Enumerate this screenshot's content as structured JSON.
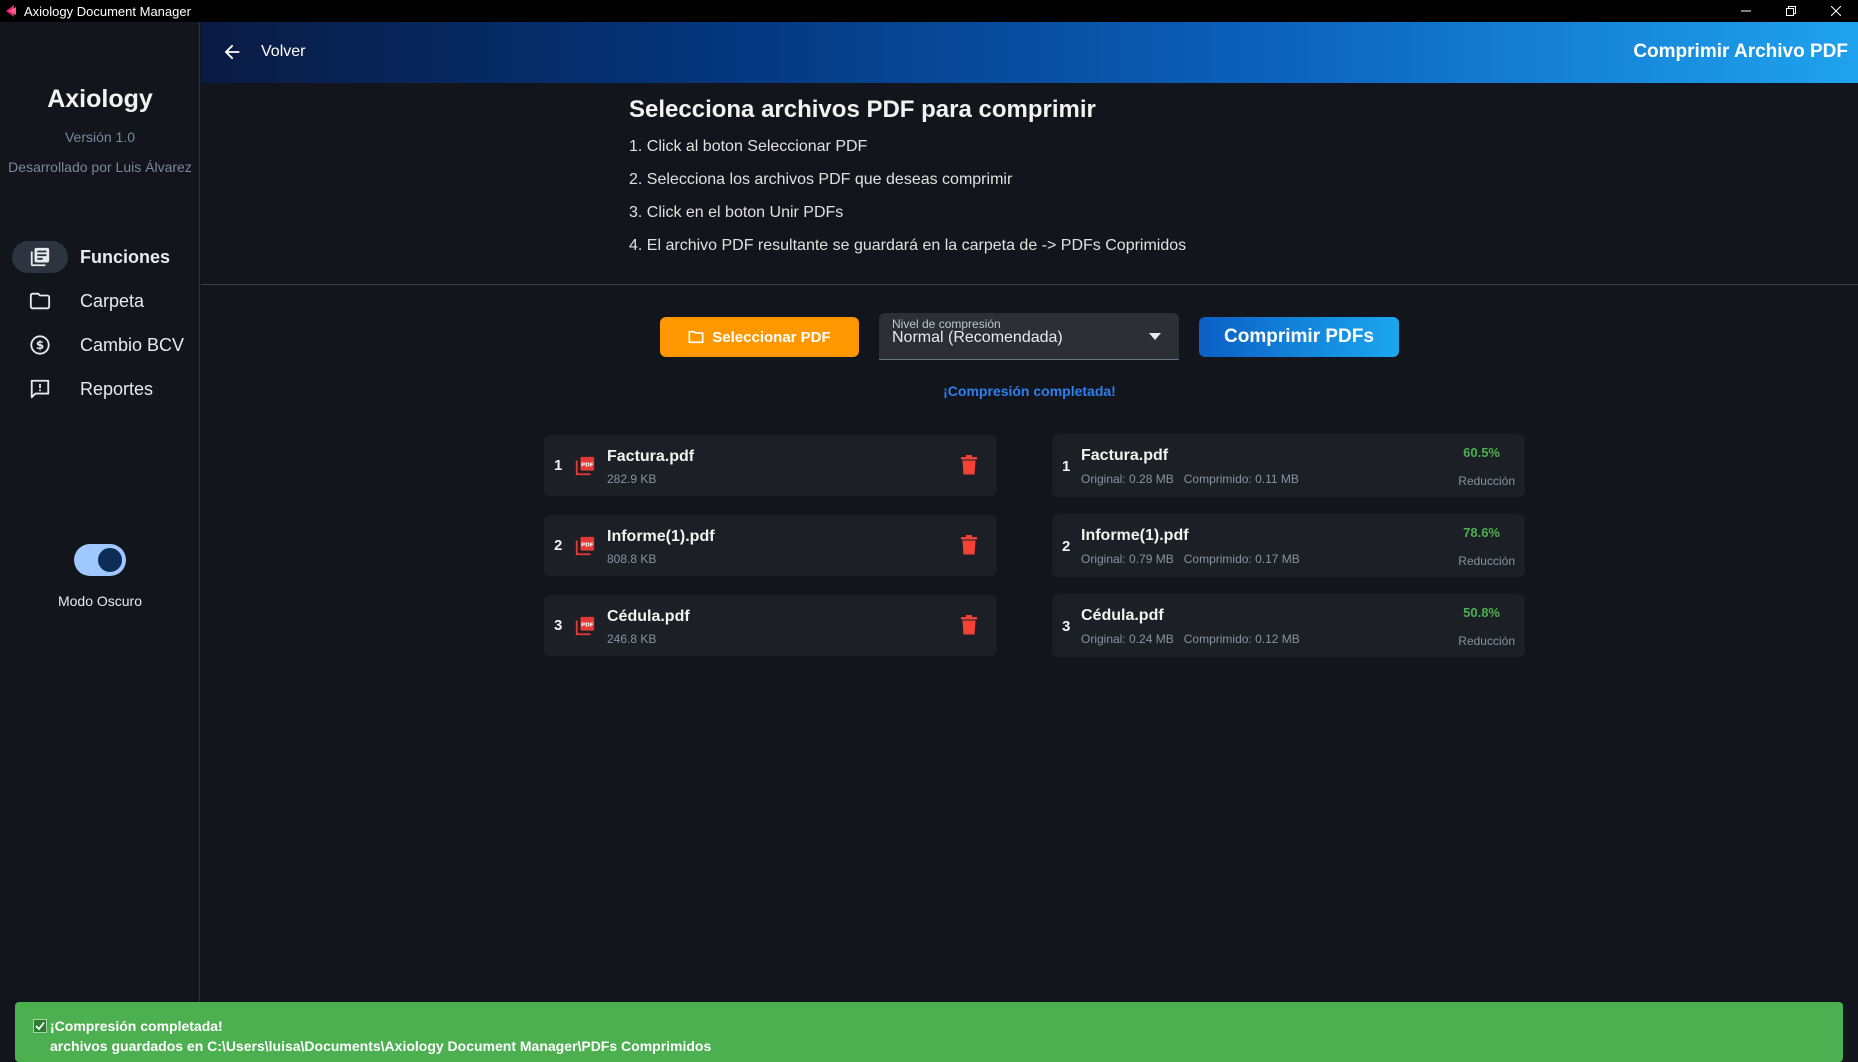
{
  "window": {
    "title": "Axiology Document Manager"
  },
  "sidebar": {
    "brand": "Axiology",
    "version": "Versión 1.0",
    "developer": "Desarrollado por Luis Álvarez",
    "items": [
      {
        "label": "Funciones",
        "icon": "library-books-icon",
        "active": true
      },
      {
        "label": "Carpeta",
        "icon": "folder-icon",
        "active": false
      },
      {
        "label": "Cambio BCV",
        "icon": "dollar-circle-icon",
        "active": false
      },
      {
        "label": "Reportes",
        "icon": "report-icon",
        "active": false
      }
    ],
    "dark_mode_label": "Modo Oscuro",
    "dark_mode_on": true
  },
  "header": {
    "back_label": "Volver",
    "title": "Comprimir Archivo PDF"
  },
  "instructions": {
    "title": "Selecciona archivos PDF para comprimir",
    "steps": [
      "1. Click al boton Seleccionar PDF",
      "2. Selecciona los archivos PDF que deseas comprimir",
      "3. Click en el boton Unir PDFs",
      "4. El archivo PDF resultante se guardará en la carpeta de -> PDFs Coprimidos"
    ]
  },
  "controls": {
    "select_label": "Seleccionar PDF",
    "compression_label": "Nivel de compresión",
    "compression_value": "Normal (Recomendada)",
    "compress_label": "Comprimir PDFs",
    "status": "¡Compresión completada!"
  },
  "files": [
    {
      "num": "1",
      "name": "Factura.pdf",
      "size": "282.9 KB"
    },
    {
      "num": "2",
      "name": "Informe(1).pdf",
      "size": "808.8 KB"
    },
    {
      "num": "3",
      "name": "Cédula.pdf",
      "size": "246.8 KB"
    }
  ],
  "results": [
    {
      "num": "1",
      "name": "Factura.pdf",
      "original": "Original: 0.28 MB",
      "compressed": "Comprimido: 0.11 MB",
      "pct": "60.5%",
      "reduction_label": "Reducción"
    },
    {
      "num": "2",
      "name": "Informe(1).pdf",
      "original": "Original: 0.79 MB",
      "compressed": "Comprimido: 0.17 MB",
      "pct": "78.6%",
      "reduction_label": "Reducción"
    },
    {
      "num": "3",
      "name": "Cédula.pdf",
      "original": "Original: 0.24 MB",
      "compressed": "Comprimido: 0.12 MB",
      "pct": "50.8%",
      "reduction_label": "Reducción"
    }
  ],
  "snackbar": {
    "line1": "¡Compresión completada!",
    "line2": "archivos guardados en C:\\Users\\luisa\\Documents\\Axiology Document Manager\\PDFs Comprimidos"
  },
  "colors": {
    "accent_orange": "#ff9800",
    "accent_blue": "#0b5fc4",
    "success_green": "#4caf50",
    "delete_red": "#f44336"
  }
}
